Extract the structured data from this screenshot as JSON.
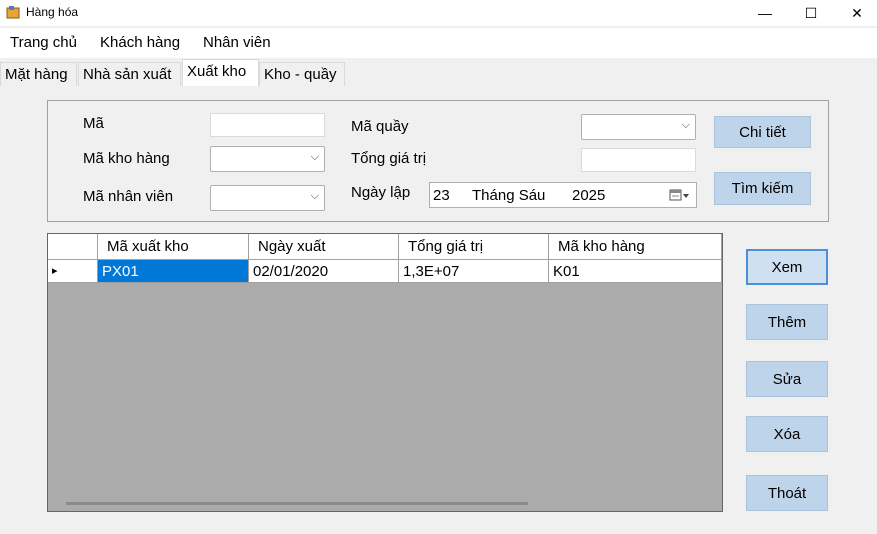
{
  "window": {
    "title": "Hàng hóa",
    "minimize_glyph": "—",
    "maximize_glyph": "☐",
    "close_glyph": "✕"
  },
  "menu": [
    "Trang chủ",
    "Khách hàng",
    "Nhân viên"
  ],
  "tabs": [
    {
      "label": "Mặt hàng",
      "active": false
    },
    {
      "label": "Nhà sản xuất",
      "active": false
    },
    {
      "label": "Xuất kho",
      "active": true
    },
    {
      "label": "Kho - quầy",
      "active": false
    }
  ],
  "form": {
    "ma_label": "Mã",
    "ma_value": "",
    "ma_kho_label": "Mã kho hàng",
    "ma_kho_value": "",
    "ma_nv_label": "Mã nhân viên",
    "ma_nv_value": "",
    "ma_quay_label": "Mã quầy",
    "ma_quay_value": "",
    "tong_label": "Tổng giá trị",
    "tong_value": "",
    "ngay_lap_label": "Ngày lập",
    "ngay_lap": {
      "day": "23",
      "month": "Tháng Sáu",
      "year": "2025"
    },
    "chi_tiet_button": "Chi tiết",
    "tim_kiem_button": "Tìm kiếm"
  },
  "grid": {
    "columns": [
      "Mã xuất kho",
      "Ngày xuất",
      "Tổng giá trị",
      "Mã kho hàng"
    ],
    "rows": [
      [
        "PX01",
        "02/01/2020",
        "1,3E+07",
        "K01"
      ]
    ],
    "row_indicator": "▸"
  },
  "actions": [
    "Xem",
    "Thêm",
    "Sửa",
    "Xóa",
    "Thoát"
  ],
  "colors": {
    "selection": "#0078d7",
    "grid_background": "#ababab",
    "button_blue": "#bed4ea"
  }
}
